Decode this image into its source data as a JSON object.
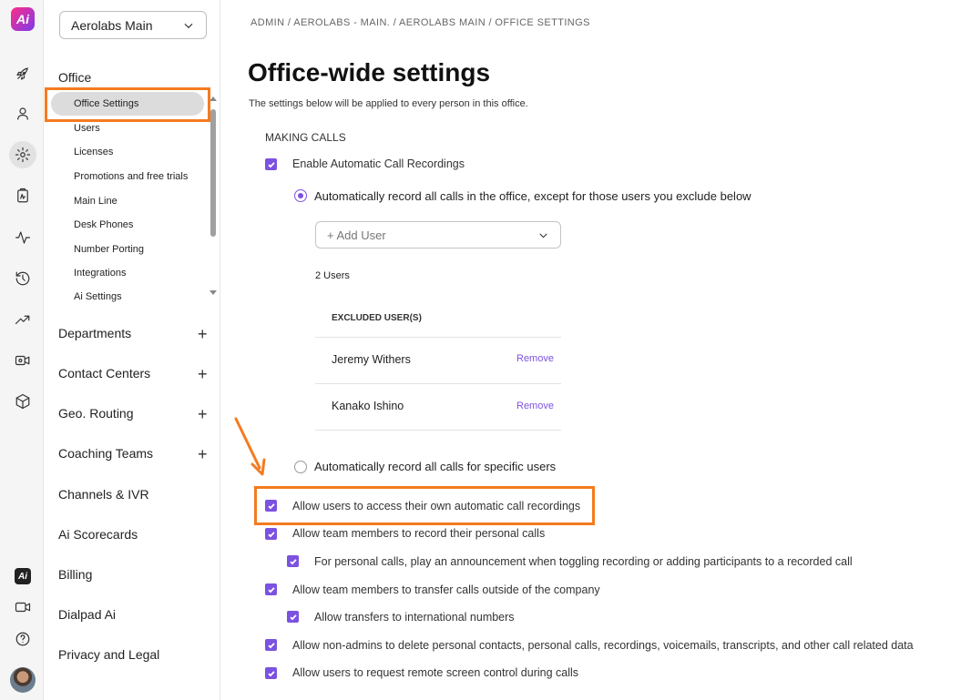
{
  "rail": {
    "logo_text": "Ai",
    "icons": [
      "rocket-icon",
      "user-icon",
      "gear-icon",
      "clipboard-icon",
      "activity-icon",
      "history-icon",
      "trend-icon",
      "video-settings-icon",
      "cube-icon"
    ],
    "bottom_icons": [
      "dialpad-ai-icon",
      "video-icon",
      "help-icon"
    ]
  },
  "sidebar": {
    "office_select": "Aerolabs Main",
    "office_section": "Office",
    "office_items": [
      "Office Settings",
      "Users",
      "Licenses",
      "Promotions and free trials",
      "Main Line",
      "Desk Phones",
      "Number Porting",
      "Integrations",
      "Ai Settings"
    ],
    "sections": [
      {
        "label": "Departments",
        "expandable": true
      },
      {
        "label": "Contact Centers",
        "expandable": true
      },
      {
        "label": "Geo. Routing",
        "expandable": true
      },
      {
        "label": "Coaching Teams",
        "expandable": true
      },
      {
        "label": "Channels & IVR",
        "expandable": false
      },
      {
        "label": "Ai Scorecards",
        "expandable": false
      },
      {
        "label": "Billing",
        "expandable": false
      },
      {
        "label": "Dialpad Ai",
        "expandable": false
      },
      {
        "label": "Privacy and Legal",
        "expandable": false
      }
    ],
    "plus": "+"
  },
  "main": {
    "breadcrumb": "ADMIN / AEROLABS - MAIN. / AEROLABS MAIN / OFFICE SETTINGS",
    "title": "Office-wide settings",
    "subtitle": "The settings below will be applied to every person in this office.",
    "section_label": "MAKING CALLS",
    "enable_recordings": "Enable Automatic Call Recordings",
    "radio_all": "Automatically record all calls in the office, except for those users you exclude below",
    "add_user_placeholder": "+ Add User",
    "users_count": "2 Users",
    "excluded_header": "EXCLUDED USER(S)",
    "excluded_users": [
      {
        "name": "Jeremy Withers",
        "action": "Remove"
      },
      {
        "name": "Kanako Ishino",
        "action": "Remove"
      }
    ],
    "radio_specific": "Automatically record all calls for specific users",
    "opt_access_own": "Allow users to access their own automatic call recordings",
    "opt_team_record": "Allow team members to record their personal calls",
    "opt_announcement": "For personal calls, play an announcement when toggling recording or adding participants to a recorded call",
    "opt_transfer_outside": "Allow team members to transfer calls outside of the company",
    "opt_international": "Allow transfers to international numbers",
    "opt_delete": "Allow non-admins to delete personal contacts, personal calls, recordings, voicemails, transcripts, and other call related data",
    "opt_remote": "Allow users to request remote screen control during calls"
  },
  "colors": {
    "accent": "#7c52e0",
    "highlight": "#f47b20"
  }
}
